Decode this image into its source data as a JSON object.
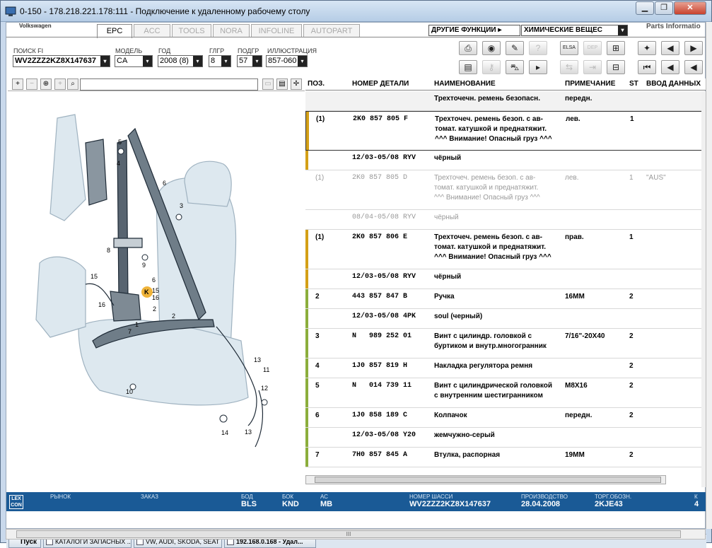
{
  "window": {
    "title": "0-150 - 178.218.221.178:111 - Подключение к удаленному рабочему столу",
    "minimize": "▁",
    "maximize": "❐",
    "close": "✕"
  },
  "header": {
    "brand": "Volkswagen",
    "parts_info": "Parts Informatio",
    "tabs": [
      "EPC",
      "ACC",
      "TOOLS",
      "NORA",
      "INFOLINE",
      "AUTOPART"
    ],
    "other_functions": "ДРУГИЕ ФУНКЦИИ ▸",
    "chem_dropdown": "ХИМИЧЕСКИЕ ВЕЩЕС"
  },
  "filters": {
    "fi_label": "ПОИСК FI",
    "fi_value": "WV2ZZZ2KZ8X147637",
    "model_label": "МОДЕЛЬ",
    "model_value": "CA",
    "year_label": "ГОД",
    "year_value": "2008 (8)",
    "glgr_label": "ГЛГР",
    "glgr_value": "8",
    "podgr_label": "ПОДГР",
    "podgr_value": "57",
    "illus_label": "ИЛЛЮСТРАЦИЯ",
    "illus_value": "857-060"
  },
  "icons": {
    "dropdown": "▾",
    "zoom_in": "+",
    "zoom_out": "−",
    "zoom_fit": "⊕",
    "search": "⌕"
  },
  "table": {
    "headers": {
      "pos": "ПОЗ.",
      "num": "НОМЕР ДЕТАЛИ",
      "name": "НАИМЕНОВАНИЕ",
      "note": "ПРИМЕЧАНИЕ",
      "st": "ST",
      "inp": "ВВОД ДАННЫХ"
    },
    "rows": [
      {
        "pos": "",
        "num": "",
        "name": "Трехточечн. ремень безопасн.",
        "note": "передн.",
        "st": "",
        "inp": ""
      },
      {
        "pos": "(1)",
        "num": "2K0 857 805 F",
        "name": "Трехточеч. ремень безоп. с ав-\nтомат. катушкой и преднатяжит.\n^^^ Внимание! Опасный груз ^^^",
        "note": "лев.",
        "st": "1",
        "inp": ""
      },
      {
        "pos": "",
        "num": "12/03-05/08 RYV",
        "name": "чёрный",
        "note": "",
        "st": "",
        "inp": ""
      },
      {
        "pos": "(1)",
        "num": "2K0 857 805 D",
        "name": "Трехточеч. ремень безоп. с ав-\nтомат. катушкой и преднатяжит.\n^^^ Внимание! Опасный груз ^^^",
        "note": "лев.",
        "st": "1",
        "inp": "\"AUS\""
      },
      {
        "pos": "",
        "num": "08/04-05/08 RYV",
        "name": "чёрный",
        "note": "",
        "st": "",
        "inp": ""
      },
      {
        "pos": "(1)",
        "num": "2K0 857 806 E",
        "name": "Трехточеч. ремень безоп. с ав-\nтомат. катушкой и преднатяжит.\n^^^ Внимание! Опасный груз ^^^",
        "note": "прав.",
        "st": "1",
        "inp": ""
      },
      {
        "pos": "",
        "num": "12/03-05/08 RYV",
        "name": "чёрный",
        "note": "",
        "st": "",
        "inp": ""
      },
      {
        "pos": "2",
        "num": "443 857 847 B",
        "name": "Ручка",
        "note": "16MM",
        "st": "2",
        "inp": ""
      },
      {
        "pos": "",
        "num": "12/03-05/08 4PK",
        "name": "soul (черный)",
        "note": "",
        "st": "",
        "inp": ""
      },
      {
        "pos": "3",
        "num": "N   989 252 01",
        "name": "Винт с цилиндр. головкой с\nбуртиком и внутр.многогранник",
        "note": "7/16\"-20X40",
        "st": "2",
        "inp": ""
      },
      {
        "pos": "4",
        "num": "1J0 857 819 H",
        "name": "Накладка регулятора ремня",
        "note": "",
        "st": "2",
        "inp": ""
      },
      {
        "pos": "5",
        "num": "N   014 739 11",
        "name": "Винт с цилиндрической головкой\nс внутренним шестигранником",
        "note": "M8X16",
        "st": "2",
        "inp": ""
      },
      {
        "pos": "6",
        "num": "1J0 858 189 C",
        "name": "Колпачок",
        "note": "передн.",
        "st": "2",
        "inp": ""
      },
      {
        "pos": "",
        "num": "12/03-05/08 Y20",
        "name": "жемчужно-серый",
        "note": "",
        "st": "",
        "inp": ""
      },
      {
        "pos": "7",
        "num": "7H0 857 845 A",
        "name": "Втулка, распорная",
        "note": "19MM",
        "st": "2",
        "inp": ""
      }
    ]
  },
  "illustration": {
    "callouts": [
      "5",
      "4",
      "6",
      "3",
      "8",
      "9",
      "15",
      "16",
      "6",
      "15",
      "16",
      "2",
      "7",
      "1",
      "10",
      "2",
      "13",
      "11",
      "12",
      "14",
      "13",
      "K"
    ]
  },
  "status": {
    "logo": "LEX\nCON",
    "market_label": "РЫНОК",
    "order_label": "ЗАКАЗ",
    "bod_label": "БОД",
    "bod_value": "BLS",
    "bok_label": "БОК",
    "bok_value": "KND",
    "ac_label": "АС",
    "ac_value": "MB",
    "chassis_label": "НОМЕР ШАССИ",
    "chassis_value": "WV2ZZZ2KZ8X147637",
    "prod_label": "ПРОИЗВОДСТВО",
    "prod_value": "28.04.2008",
    "torg_label": "ТОРГ.ОБОЗН.",
    "torg_value": "2KJE43",
    "k_label": "К",
    "k_value": "4"
  },
  "taskbar": {
    "start": "Пуск",
    "items": [
      "КАТАЛОГИ ЗАПАСНЫХ ...",
      "VW, AUDI, SKODA, SEAT",
      "192.168.0.168 - Удал..."
    ]
  },
  "scroll": {
    "thumb_grip": "III"
  }
}
